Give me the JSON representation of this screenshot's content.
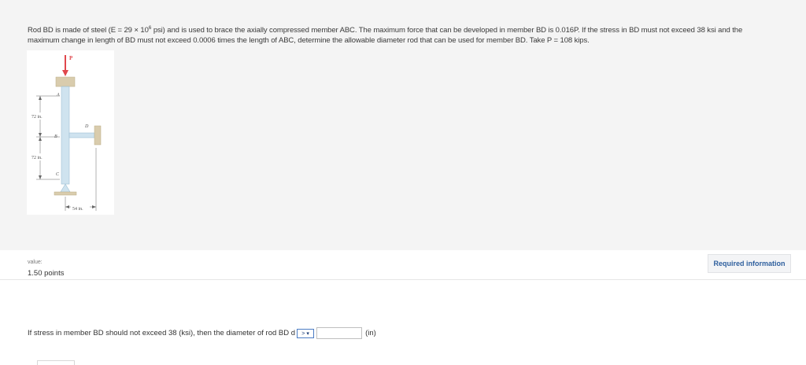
{
  "problem": {
    "line1_a": "Rod BD is made of steel (E = 29 × 10",
    "line1_sup": "6",
    "line1_b": " psi) and is used to brace the axially compressed member ABC. The maximum force that can be developed in member BD is 0.016P. If the stress in BD must not exceed 38 ksi and the",
    "line2": "maximum change in length of BD must not exceed 0.0006 times the length of ABC, determine the allowable diameter rod that can be used for member BD. Take P = 108 kips."
  },
  "figure": {
    "label_p": "P",
    "label_a": "A",
    "label_b": "B",
    "label_c": "C",
    "label_d": "D",
    "dim_top": "72 in.",
    "dim_bottom": "72 in.",
    "dim_horizontal": "54 in."
  },
  "meta": {
    "value_label": "value:",
    "points": "1.50 points",
    "required_button": "Required information"
  },
  "question": {
    "prompt": "If stress in member BD should not exceed 38 (ksi), then the diameter of rod BD d",
    "selector": "> ▾",
    "answer_value": "",
    "unit": "(in)"
  },
  "colors": {
    "accent_link": "#2e5f9e",
    "selector_border": "#4c7cc4",
    "load_arrow": "#e0474c",
    "member_fill": "#cfe3ef",
    "support_fill": "#d9ccad"
  }
}
